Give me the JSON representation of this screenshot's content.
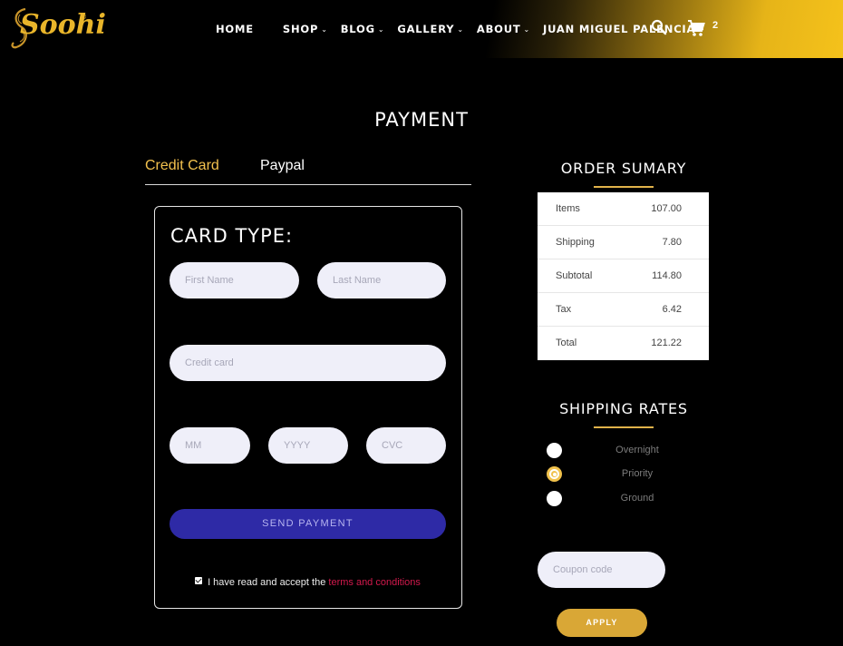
{
  "brand": {
    "name": "Soohi",
    "reg_mark": "®"
  },
  "nav": {
    "items": [
      {
        "label": "HOME",
        "has_dropdown": false
      },
      {
        "label": "SHOP",
        "has_dropdown": true
      },
      {
        "label": "BLOG",
        "has_dropdown": true
      },
      {
        "label": "GALLERY",
        "has_dropdown": true
      },
      {
        "label": "ABOUT",
        "has_dropdown": true
      },
      {
        "label": "JUAN MIGUEL PALENCIA",
        "has_dropdown": true
      }
    ],
    "search_icon": "search-icon",
    "cart_icon": "cart-icon",
    "cart_count": "2"
  },
  "page": {
    "title": "PAYMENT"
  },
  "tabs": [
    {
      "label": "Credit Card",
      "active": true
    },
    {
      "label": "Paypal",
      "active": false
    }
  ],
  "form": {
    "title": "CARD TYPE:",
    "first_name_placeholder": "First Name",
    "last_name_placeholder": "Last Name",
    "credit_card_placeholder": "Credit card",
    "mm_placeholder": "MM",
    "yyyy_placeholder": "YYYY",
    "cvc_placeholder": "CVC",
    "submit_label": "SEND PAYMENT",
    "terms_text": "I have read and accept the ",
    "terms_link": "terms and conditions",
    "terms_checked": true
  },
  "order_summary": {
    "title": "ORDER SUMARY",
    "rows": [
      {
        "label": "Items",
        "value": "107.00"
      },
      {
        "label": "Shipping",
        "value": "7.80"
      },
      {
        "label": "Subtotal",
        "value": "114.80"
      },
      {
        "label": "Tax",
        "value": "6.42"
      },
      {
        "label": "Total",
        "value": "121.22"
      }
    ]
  },
  "shipping_rates": {
    "title": "SHIPPING RATES",
    "options": [
      {
        "label": "Overnight",
        "selected": false
      },
      {
        "label": "Priority",
        "selected": true
      },
      {
        "label": "Ground",
        "selected": false
      }
    ]
  },
  "coupon": {
    "placeholder": "Coupon code",
    "apply_label": "APPLY"
  },
  "colors": {
    "accent": "#f2c14e",
    "button_primary": "#2e2aa6",
    "apply": "#d9a736",
    "link": "#d3194d"
  }
}
